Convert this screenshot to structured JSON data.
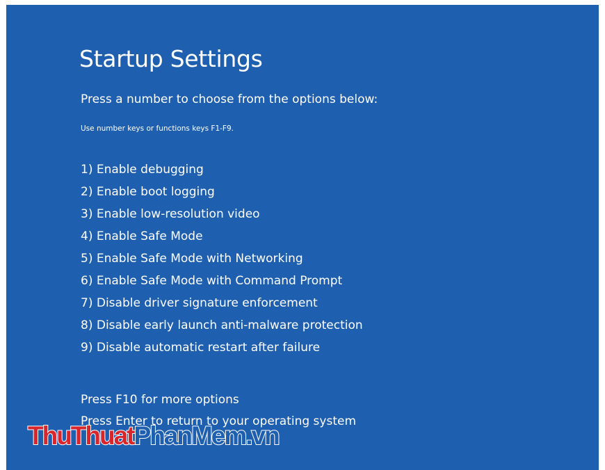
{
  "screen": {
    "background_color": "#1f5faf",
    "title": "Startup Settings",
    "subtitle": "Press a number to choose from the options below:",
    "hint": "Use number keys or functions keys F1-F9."
  },
  "options": [
    "1) Enable debugging",
    "2) Enable boot logging",
    "3) Enable low-resolution video",
    "4) Enable Safe Mode",
    "5) Enable Safe Mode with Networking",
    "6) Enable Safe Mode with Command Prompt",
    "7) Disable driver signature enforcement",
    "8) Disable early launch anti-malware protection",
    "9) Disable automatic restart after failure"
  ],
  "footer": {
    "more_options": "Press F10 for more options",
    "return": "Press Enter to return to your operating system"
  },
  "watermark": {
    "part1": "ThuThuat",
    "part2": "PhanMem.vn",
    "color1": "#d9262c",
    "color2": "#1f5faf"
  }
}
